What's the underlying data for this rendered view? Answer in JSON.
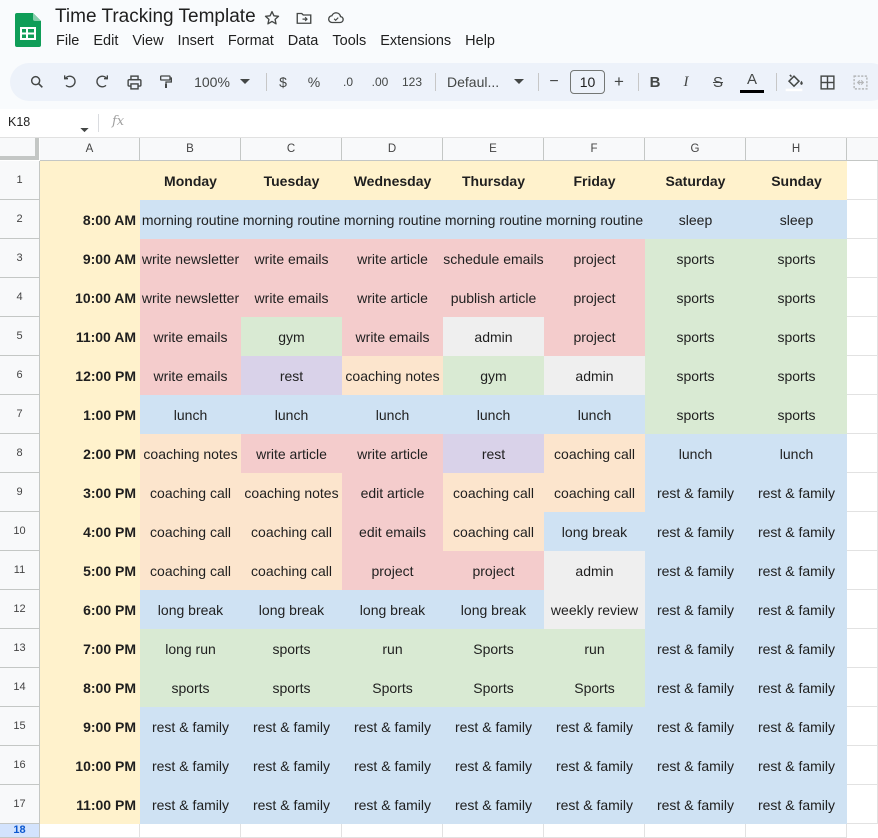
{
  "app": {
    "title": "Time Tracking Template",
    "menu": [
      "File",
      "Edit",
      "View",
      "Insert",
      "Format",
      "Data",
      "Tools",
      "Extensions",
      "Help"
    ]
  },
  "toolbar": {
    "zoom": "100%",
    "currency": "$",
    "percent": "%",
    "dec_decrease": ".0",
    "dec_increase": ".00",
    "number_format": "123",
    "font": "Defaul...",
    "font_size": "10",
    "minus": "−",
    "plus": "+",
    "bold": "B",
    "italic": "I",
    "strike": "S",
    "text_color": "A",
    "text_color_swatch": "#000000"
  },
  "formula_bar": {
    "cell_ref": "K18",
    "fx_label": "fx",
    "value": ""
  },
  "colors": {
    "pink": "#f4cccc",
    "green": "#d9ead3",
    "blue": "#cfe2f3",
    "orange": "#fce5cd",
    "purple": "#d9d2e9",
    "grey": "#efefef",
    "yellow": "#fff2cc"
  },
  "columns": [
    "A",
    "B",
    "C",
    "D",
    "E",
    "F",
    "G",
    "H"
  ],
  "rows": [
    "1",
    "2",
    "3",
    "4",
    "5",
    "6",
    "7",
    "8",
    "9",
    "10",
    "11",
    "12",
    "13",
    "14",
    "15",
    "16",
    "17",
    "18"
  ],
  "selected_row": "18",
  "days": [
    "Monday",
    "Tuesday",
    "Wednesday",
    "Thursday",
    "Friday",
    "Saturday",
    "Sunday"
  ],
  "schedule": [
    {
      "time": "8:00 AM",
      "cells": [
        [
          "morning routine",
          "blue"
        ],
        [
          "morning routine",
          "blue"
        ],
        [
          "morning routine",
          "blue"
        ],
        [
          "morning routine",
          "blue"
        ],
        [
          "morning routine",
          "blue"
        ],
        [
          "sleep",
          "blue"
        ],
        [
          "sleep",
          "blue"
        ]
      ]
    },
    {
      "time": "9:00 AM",
      "cells": [
        [
          "write newsletter",
          "pink"
        ],
        [
          "write emails",
          "pink"
        ],
        [
          "write article",
          "pink"
        ],
        [
          "schedule emails",
          "pink"
        ],
        [
          "project",
          "pink"
        ],
        [
          "sports",
          "green"
        ],
        [
          "sports",
          "green"
        ]
      ]
    },
    {
      "time": "10:00 AM",
      "cells": [
        [
          "write newsletter",
          "pink"
        ],
        [
          "write emails",
          "pink"
        ],
        [
          "write article",
          "pink"
        ],
        [
          "publish article",
          "pink"
        ],
        [
          "project",
          "pink"
        ],
        [
          "sports",
          "green"
        ],
        [
          "sports",
          "green"
        ]
      ]
    },
    {
      "time": "11:00 AM",
      "cells": [
        [
          "write emails",
          "pink"
        ],
        [
          "gym",
          "green"
        ],
        [
          "write emails",
          "pink"
        ],
        [
          "admin",
          "grey"
        ],
        [
          "project",
          "pink"
        ],
        [
          "sports",
          "green"
        ],
        [
          "sports",
          "green"
        ]
      ]
    },
    {
      "time": "12:00 PM",
      "cells": [
        [
          "write emails",
          "pink"
        ],
        [
          "rest",
          "purple"
        ],
        [
          "coaching notes",
          "orange"
        ],
        [
          "gym",
          "green"
        ],
        [
          "admin",
          "grey"
        ],
        [
          "sports",
          "green"
        ],
        [
          "sports",
          "green"
        ]
      ]
    },
    {
      "time": "1:00 PM",
      "cells": [
        [
          "lunch",
          "blue"
        ],
        [
          "lunch",
          "blue"
        ],
        [
          "lunch",
          "blue"
        ],
        [
          "lunch",
          "blue"
        ],
        [
          "lunch",
          "blue"
        ],
        [
          "sports",
          "green"
        ],
        [
          "sports",
          "green"
        ]
      ]
    },
    {
      "time": "2:00 PM",
      "cells": [
        [
          "coaching notes",
          "orange"
        ],
        [
          "write article",
          "pink"
        ],
        [
          "write article",
          "pink"
        ],
        [
          "rest",
          "purple"
        ],
        [
          "coaching call",
          "orange"
        ],
        [
          "lunch",
          "blue"
        ],
        [
          "lunch",
          "blue"
        ]
      ]
    },
    {
      "time": "3:00 PM",
      "cells": [
        [
          "coaching call",
          "orange"
        ],
        [
          "coaching notes",
          "orange"
        ],
        [
          "edit article",
          "pink"
        ],
        [
          "coaching call",
          "orange"
        ],
        [
          "coaching call",
          "orange"
        ],
        [
          "rest & family",
          "blue"
        ],
        [
          "rest & family",
          "blue"
        ]
      ]
    },
    {
      "time": "4:00 PM",
      "cells": [
        [
          "coaching call",
          "orange"
        ],
        [
          "coaching call",
          "orange"
        ],
        [
          "edit emails",
          "pink"
        ],
        [
          "coaching call",
          "orange"
        ],
        [
          "long break",
          "blue"
        ],
        [
          "rest & family",
          "blue"
        ],
        [
          "rest & family",
          "blue"
        ]
      ]
    },
    {
      "time": "5:00 PM",
      "cells": [
        [
          "coaching call",
          "orange"
        ],
        [
          "coaching call",
          "orange"
        ],
        [
          "project",
          "pink"
        ],
        [
          "project",
          "pink"
        ],
        [
          "admin",
          "grey"
        ],
        [
          "rest & family",
          "blue"
        ],
        [
          "rest & family",
          "blue"
        ]
      ]
    },
    {
      "time": "6:00 PM",
      "cells": [
        [
          "long break",
          "blue"
        ],
        [
          "long break",
          "blue"
        ],
        [
          "long break",
          "blue"
        ],
        [
          "long break",
          "blue"
        ],
        [
          "weekly review",
          "grey"
        ],
        [
          "rest & family",
          "blue"
        ],
        [
          "rest & family",
          "blue"
        ]
      ]
    },
    {
      "time": "7:00 PM",
      "cells": [
        [
          "long run",
          "green"
        ],
        [
          "sports",
          "green"
        ],
        [
          "run",
          "green"
        ],
        [
          "Sports",
          "green"
        ],
        [
          "run",
          "green"
        ],
        [
          "rest & family",
          "blue"
        ],
        [
          "rest & family",
          "blue"
        ]
      ]
    },
    {
      "time": "8:00 PM",
      "cells": [
        [
          "sports",
          "green"
        ],
        [
          "sports",
          "green"
        ],
        [
          "Sports",
          "green"
        ],
        [
          "Sports",
          "green"
        ],
        [
          "Sports",
          "green"
        ],
        [
          "rest & family",
          "blue"
        ],
        [
          "rest & family",
          "blue"
        ]
      ]
    },
    {
      "time": "9:00 PM",
      "cells": [
        [
          "rest & family",
          "blue"
        ],
        [
          "rest & family",
          "blue"
        ],
        [
          "rest & family",
          "blue"
        ],
        [
          "rest & family",
          "blue"
        ],
        [
          "rest & family",
          "blue"
        ],
        [
          "rest & family",
          "blue"
        ],
        [
          "rest & family",
          "blue"
        ]
      ]
    },
    {
      "time": "10:00 PM",
      "cells": [
        [
          "rest & family",
          "blue"
        ],
        [
          "rest & family",
          "blue"
        ],
        [
          "rest & family",
          "blue"
        ],
        [
          "rest & family",
          "blue"
        ],
        [
          "rest & family",
          "blue"
        ],
        [
          "rest & family",
          "blue"
        ],
        [
          "rest & family",
          "blue"
        ]
      ]
    },
    {
      "time": "11:00 PM",
      "cells": [
        [
          "rest & family",
          "blue"
        ],
        [
          "rest & family",
          "blue"
        ],
        [
          "rest & family",
          "blue"
        ],
        [
          "rest & family",
          "blue"
        ],
        [
          "rest & family",
          "blue"
        ],
        [
          "rest & family",
          "blue"
        ],
        [
          "rest & family",
          "blue"
        ]
      ]
    }
  ]
}
